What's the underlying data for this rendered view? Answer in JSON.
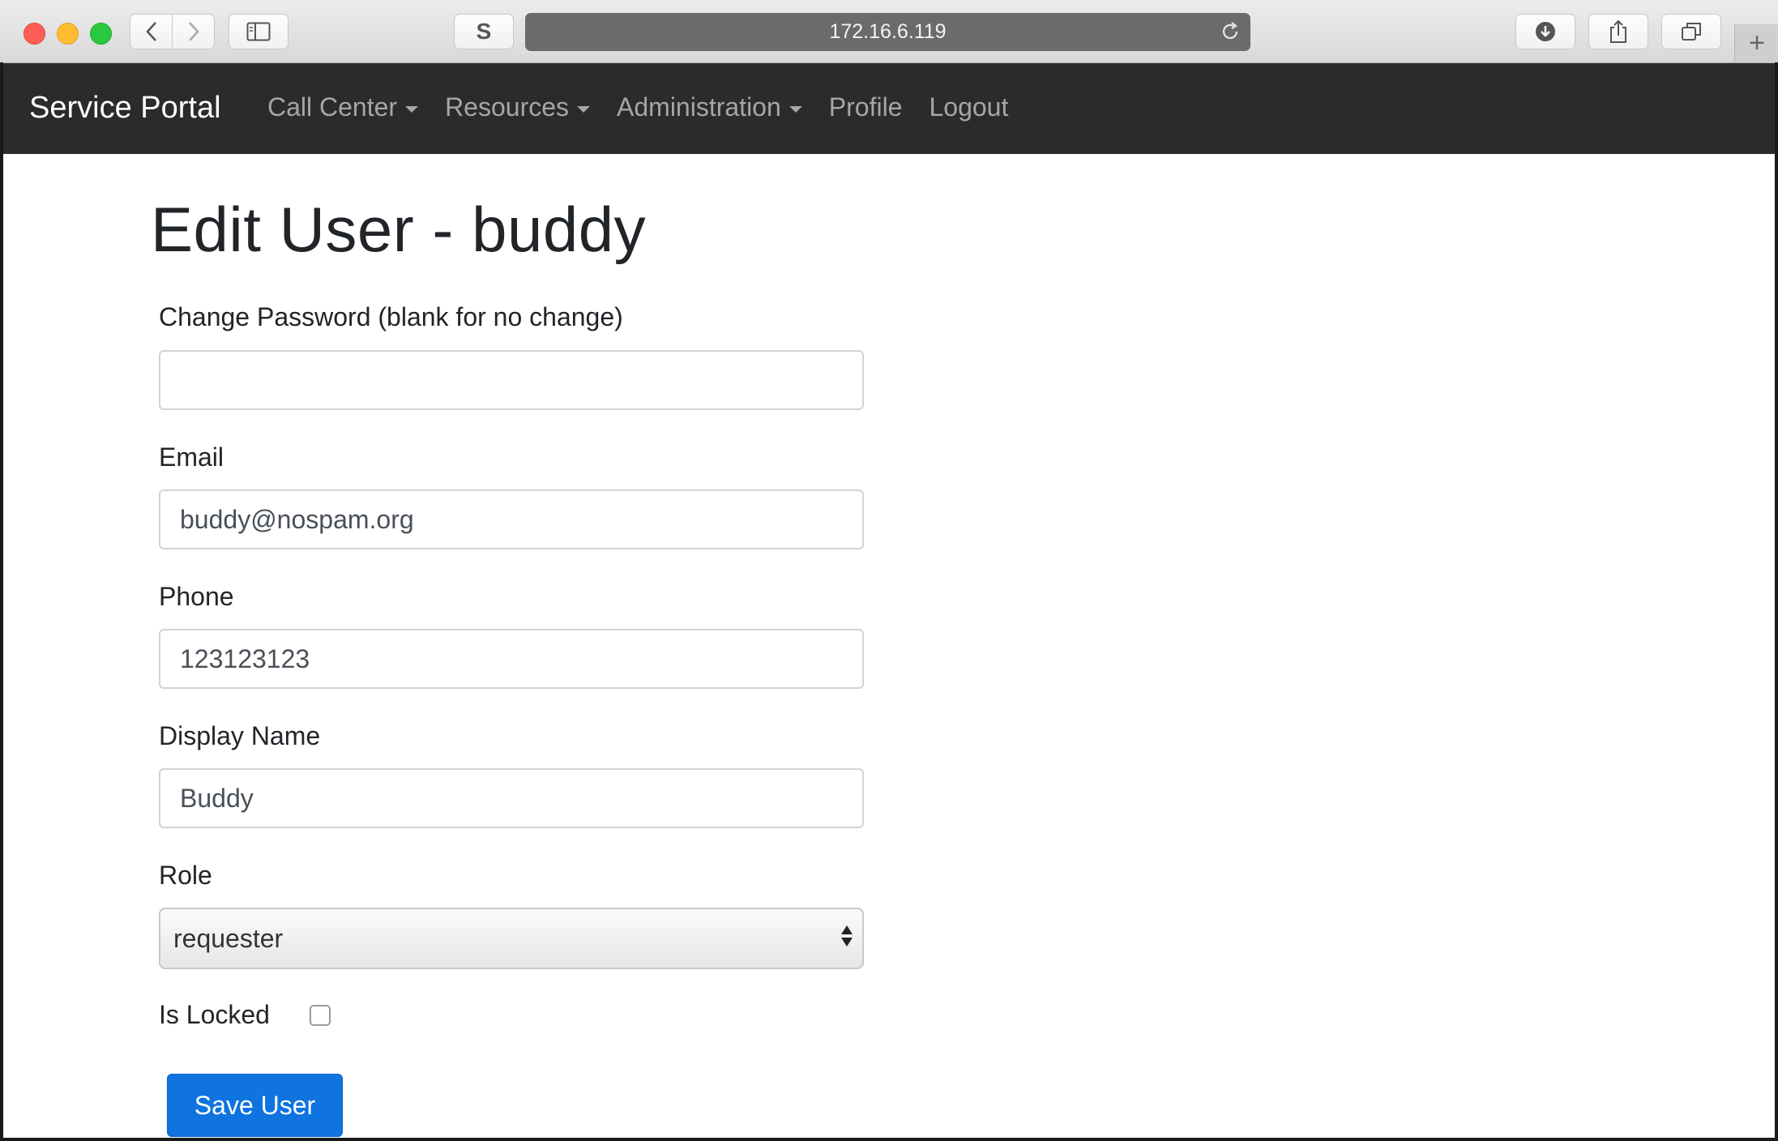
{
  "browser": {
    "url": "172.16.6.119",
    "s_button_label": "S",
    "new_tab_label": "+"
  },
  "navbar": {
    "brand": "Service Portal",
    "items": [
      {
        "label": "Call Center",
        "dropdown": true
      },
      {
        "label": "Resources",
        "dropdown": true
      },
      {
        "label": "Administration",
        "dropdown": true
      },
      {
        "label": "Profile",
        "dropdown": false
      },
      {
        "label": "Logout",
        "dropdown": false
      }
    ]
  },
  "page": {
    "title": "Edit User - buddy"
  },
  "form": {
    "password": {
      "label": "Change Password (blank for no change)",
      "value": ""
    },
    "email": {
      "label": "Email",
      "value": "buddy@nospam.org"
    },
    "phone": {
      "label": "Phone",
      "value": "123123123"
    },
    "display_name": {
      "label": "Display Name",
      "value": "Buddy"
    },
    "role": {
      "label": "Role",
      "value": "requester"
    },
    "is_locked": {
      "label": "Is Locked",
      "checked": false
    },
    "save_label": "Save User"
  },
  "colors": {
    "navbar_bg": "#2b2b2b",
    "primary_button": "#0f73e0"
  }
}
